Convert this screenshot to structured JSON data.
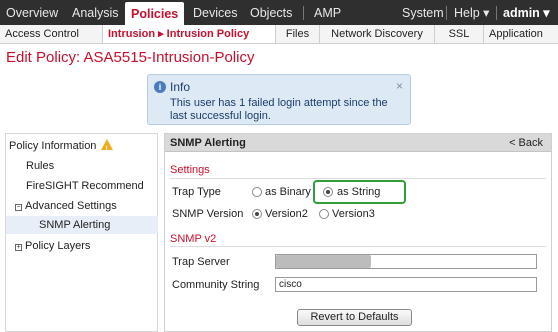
{
  "top_nav": {
    "items": [
      "Overview",
      "Analysis",
      "Policies",
      "Devices",
      "Objects",
      "AMP"
    ],
    "system": "System",
    "help": "Help ▾",
    "user": "admin ▾"
  },
  "sub_nav": {
    "tabs": [
      "Access Control",
      "Intrusion ▸ Intrusion Policy",
      "Files",
      "Network Discovery",
      "SSL",
      "Application"
    ]
  },
  "page_title": "Edit Policy: ASA5515-Intrusion-Policy",
  "info": {
    "title": "Info",
    "message": "This user has 1 failed login attempt since the last successful login.",
    "close": "×"
  },
  "sidebar": {
    "items": [
      "Policy Information",
      "Rules",
      "FireSIGHT Recommend",
      "Advanced Settings",
      "SNMP Alerting",
      "Policy Layers"
    ]
  },
  "panel": {
    "header": "SNMP Alerting",
    "back": "< Back",
    "settings_title": "Settings",
    "trap_type_label": "Trap Type",
    "trap_binary": "as Binary",
    "trap_string": "as String",
    "snmp_version_label": "SNMP Version",
    "version2": "Version2",
    "version3": "Version3",
    "snmpv2_title": "SNMP v2",
    "trap_server_label": "Trap Server",
    "community_label": "Community String",
    "community_value": "cisco",
    "revert": "Revert to Defaults"
  }
}
